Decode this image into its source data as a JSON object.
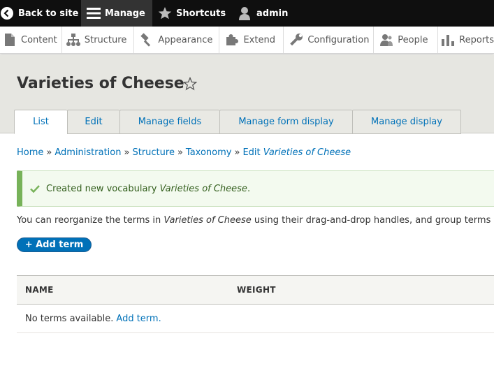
{
  "toolbar": {
    "back_label": "Back to site",
    "manage_label": "Manage",
    "shortcuts_label": "Shortcuts",
    "user_label": "admin"
  },
  "tray": {
    "content": "Content",
    "structure": "Structure",
    "appearance": "Appearance",
    "extend": "Extend",
    "configuration": "Configuration",
    "people": "People",
    "reports": "Reports"
  },
  "page": {
    "title": "Varieties of Cheese"
  },
  "tabs": [
    "List",
    "Edit",
    "Manage fields",
    "Manage form display",
    "Manage display"
  ],
  "breadcrumb": {
    "home": "Home",
    "administration": "Administration",
    "structure": "Structure",
    "taxonomy": "Taxonomy",
    "edit_prefix": "Edit",
    "edit_name": "Varieties of Cheese",
    "separator": "»"
  },
  "status": {
    "prefix": "Created new vocabulary",
    "name": "Varieties of Cheese",
    "suffix": "."
  },
  "help": {
    "prefix": "You can reorganize the terms in",
    "name": "Varieties of Cheese",
    "suffix": "using their drag-and-drop handles, and group terms u"
  },
  "add_term_button": "+ Add term",
  "table": {
    "columns": [
      "NAME",
      "WEIGHT"
    ],
    "empty_text": "No terms available.",
    "empty_link": "Add term."
  },
  "colors": {
    "link": "#0071b8",
    "toolbar_bg": "#0f0f0f",
    "header_bg": "#e6e6e1",
    "status_border": "#77b259"
  }
}
